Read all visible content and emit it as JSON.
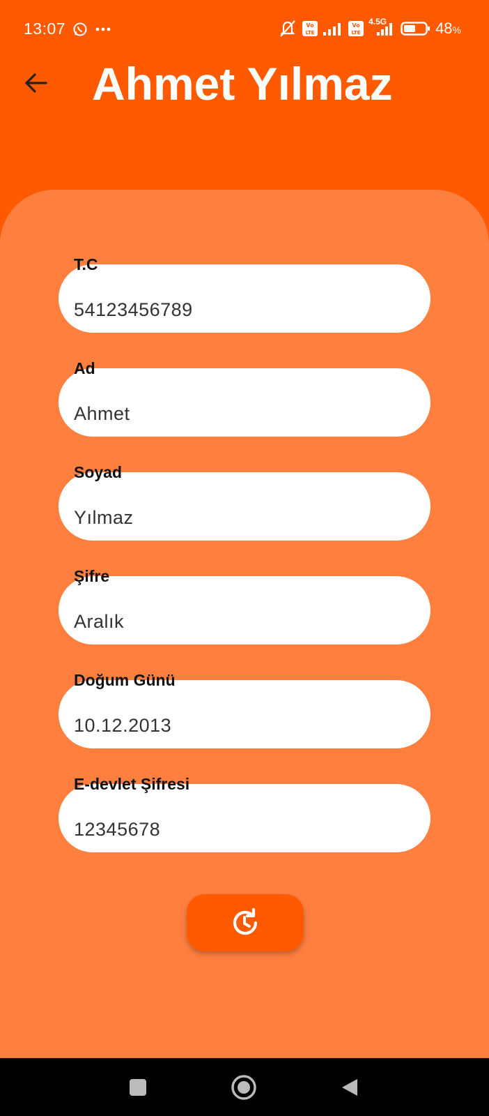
{
  "status_bar": {
    "time": "13:07",
    "battery_percent": "48",
    "battery_unit": "%",
    "icons": [
      "whatsapp-icon",
      "more-dots-icon",
      "mute-vibrate-icon",
      "volte-icon",
      "signal-icon",
      "volte-icon",
      "4.5g-signal-icon",
      "battery-icon"
    ],
    "network_label": "4.5G"
  },
  "header": {
    "title": "Ahmet Yılmaz",
    "back_icon": "arrow-left-icon"
  },
  "form": {
    "fields": [
      {
        "label": "T.C",
        "value": "54123456789"
      },
      {
        "label": "Ad",
        "value": "Ahmet"
      },
      {
        "label": "Soyad",
        "value": "Yılmaz"
      },
      {
        "label": "Şifre",
        "value": "Aralık"
      },
      {
        "label": "Doğum Günü",
        "value": "10.12.2013"
      },
      {
        "label": "E-devlet Şifresi",
        "value": "12345678"
      }
    ],
    "action_icon": "restore-history-icon"
  },
  "navigation": {
    "buttons": [
      "recents-square-icon",
      "home-circle-icon",
      "back-triangle-icon"
    ]
  },
  "colors": {
    "header_bg": "#FF5A00",
    "card_bg": "#FF7F3F",
    "button_bg": "#FF5A00"
  }
}
